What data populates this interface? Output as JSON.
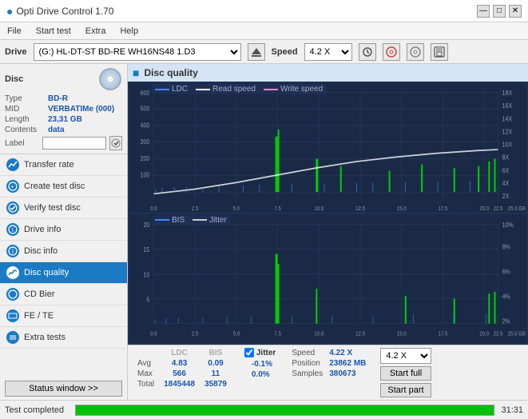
{
  "app": {
    "title": "Opti Drive Control 1.70",
    "title_icon": "●"
  },
  "title_bar": {
    "minimize": "—",
    "maximize": "□",
    "close": "✕"
  },
  "menu": {
    "items": [
      "File",
      "Start test",
      "Extra",
      "Help"
    ]
  },
  "drive_bar": {
    "label": "Drive",
    "drive_value": "(G:)  HL-DT-ST BD-RE  WH16NS48 1.D3",
    "speed_label": "Speed",
    "speed_value": "4.2 X"
  },
  "disc": {
    "title": "Disc",
    "type_label": "Type",
    "type_value": "BD-R",
    "mid_label": "MID",
    "mid_value": "VERBATIMe (000)",
    "length_label": "Length",
    "length_value": "23,31 GB",
    "contents_label": "Contents",
    "contents_value": "data",
    "label_label": "Label",
    "label_value": ""
  },
  "nav": {
    "items": [
      {
        "id": "transfer-rate",
        "label": "Transfer rate",
        "active": false
      },
      {
        "id": "create-test-disc",
        "label": "Create test disc",
        "active": false
      },
      {
        "id": "verify-test-disc",
        "label": "Verify test disc",
        "active": false
      },
      {
        "id": "drive-info",
        "label": "Drive info",
        "active": false
      },
      {
        "id": "disc-info",
        "label": "Disc info",
        "active": false
      },
      {
        "id": "disc-quality",
        "label": "Disc quality",
        "active": true
      },
      {
        "id": "cd-bier",
        "label": "CD Bier",
        "active": false
      },
      {
        "id": "fe-te",
        "label": "FE / TE",
        "active": false
      },
      {
        "id": "extra-tests",
        "label": "Extra tests",
        "active": false
      }
    ]
  },
  "disc_quality": {
    "title": "Disc quality",
    "legend": {
      "ldc": "LDC",
      "read_speed": "Read speed",
      "write_speed": "Write speed",
      "bis": "BIS",
      "jitter": "Jitter"
    },
    "chart1": {
      "y_max": 600,
      "y_labels_left": [
        "600",
        "500",
        "400",
        "300",
        "200",
        "100"
      ],
      "y_labels_right": [
        "18X",
        "16X",
        "14X",
        "12X",
        "10X",
        "8X",
        "6X",
        "4X",
        "2X"
      ],
      "x_labels": [
        "0.0",
        "2.5",
        "5.0",
        "7.5",
        "10.0",
        "12.5",
        "15.0",
        "17.5",
        "20.0",
        "22.5",
        "25.0 GB"
      ]
    },
    "chart2": {
      "y_max": 20,
      "y_labels_left": [
        "20",
        "15",
        "10",
        "5"
      ],
      "y_labels_right": [
        "10%",
        "8%",
        "6%",
        "4%",
        "2%"
      ],
      "x_labels": [
        "0.0",
        "2.5",
        "5.0",
        "7.5",
        "10.0",
        "12.5",
        "15.0",
        "17.5",
        "20.0",
        "22.5",
        "25.0 GB"
      ]
    }
  },
  "stats": {
    "headers": [
      "LDC",
      "BIS",
      "",
      "Jitter",
      "Speed",
      ""
    ],
    "avg_label": "Avg",
    "avg_ldc": "4.83",
    "avg_bis": "0.09",
    "avg_jitter": "-0.1%",
    "max_label": "Max",
    "max_ldc": "566",
    "max_bis": "11",
    "max_jitter": "0.0%",
    "total_label": "Total",
    "total_ldc": "1845448",
    "total_bis": "35879",
    "jitter_checked": true,
    "speed_label": "Speed",
    "speed_value": "4.22 X",
    "speed_select": "4.2 X",
    "position_label": "Position",
    "position_value": "23862 MB",
    "samples_label": "Samples",
    "samples_value": "380673",
    "btn_start_full": "Start full",
    "btn_start_part": "Start part"
  },
  "status_bar": {
    "text": "Test completed",
    "progress": 100,
    "time": "31:31"
  }
}
